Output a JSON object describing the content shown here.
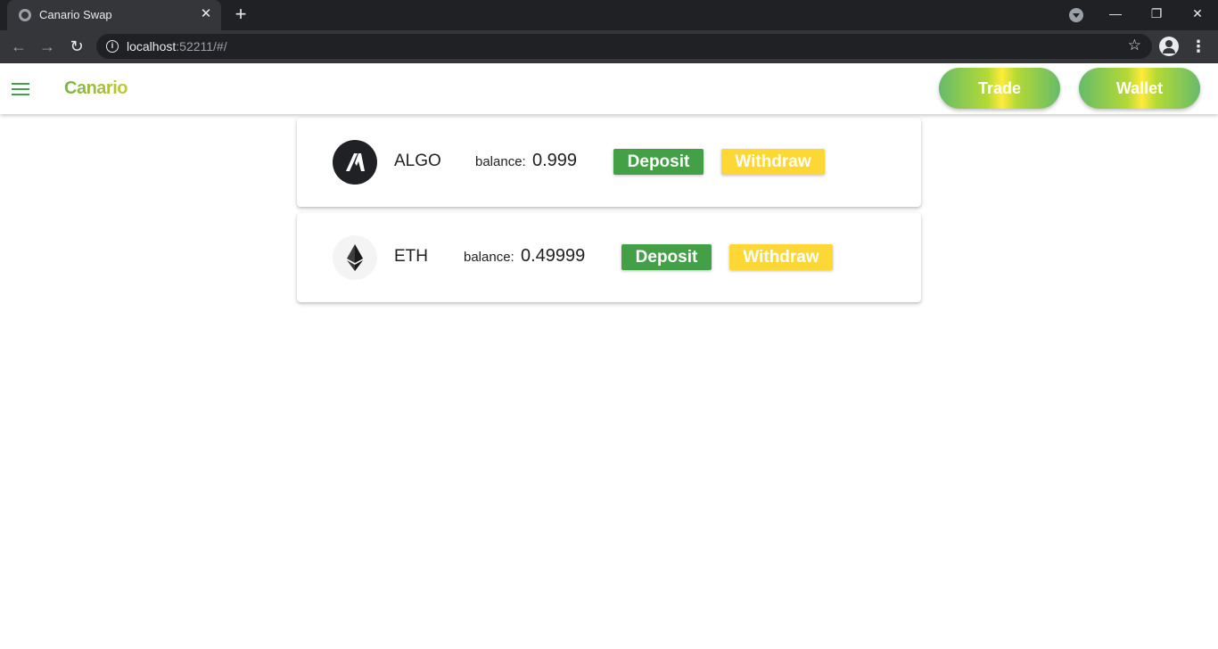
{
  "browser": {
    "tab_title": "Canario Swap",
    "tab_close": "✕",
    "new_tab": "+",
    "url_host": "localhost",
    "url_rest": ":52211/#/",
    "window_controls": {
      "minimize": "—",
      "restore": "❐",
      "close": "✕"
    },
    "back": "←",
    "forward": "→",
    "reload": "↻",
    "star": "☆",
    "menu": "⋮",
    "info": "i"
  },
  "app": {
    "brand": "Canario",
    "nav": {
      "trade": "Trade",
      "wallet": "Wallet"
    },
    "colors": {
      "green": "#43a047",
      "yellow": "#fdd835",
      "brand": "#8bc34a"
    }
  },
  "assets": [
    {
      "name": "ALGO",
      "balance_label": "balance:",
      "balance": "0.999",
      "deposit": "Deposit",
      "withdraw": "Withdraw",
      "icon": "algorand-logo-icon"
    },
    {
      "name": "ETH",
      "balance_label": "balance:",
      "balance": "0.49999",
      "deposit": "Deposit",
      "withdraw": "Withdraw",
      "icon": "ethereum-logo-icon"
    }
  ]
}
